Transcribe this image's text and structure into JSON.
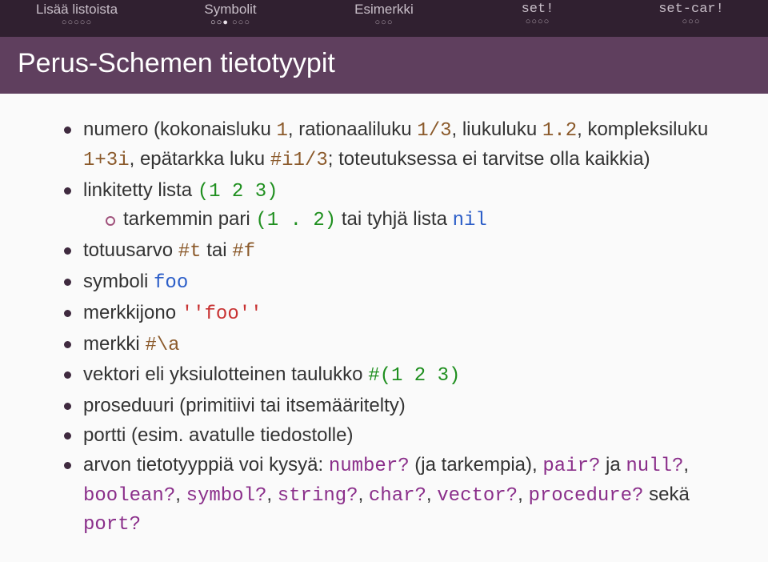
{
  "nav": [
    {
      "label": "Lisää listoista",
      "filled": 0,
      "total": 5,
      "tt": false
    },
    {
      "label": "Symbolit",
      "filled": 3,
      "total": 6,
      "tt": false,
      "split": 3
    },
    {
      "label": "Esimerkki",
      "filled": 0,
      "total": 3,
      "tt": false
    },
    {
      "label": "set!",
      "filled": 0,
      "total": 4,
      "tt": true
    },
    {
      "label": "set-car!",
      "filled": 0,
      "total": 3,
      "tt": true
    }
  ],
  "title": "Perus-Schemen tietotyypit",
  "bullets": {
    "numero": {
      "prefix": "numero (kokonaisluku ",
      "v1": "1",
      "t1": ", rationaaliluku ",
      "v2": "1/3",
      "t2": ", liukuluku ",
      "v3": "1.2",
      "t3": ", kompleksiluku ",
      "v4": "1+3i",
      "t4": ", epätarkka luku ",
      "v5": "#i1/3",
      "t5": "; toteutuksessa ei tarvitse olla kaikkia)"
    },
    "linkitetty": {
      "prefix": "linkitetty lista ",
      "v1": "(1 2 3)"
    },
    "tarkemmin": {
      "prefix": "tarkemmin pari ",
      "v1": "(1 . 2)",
      "mid": " tai tyhjä lista ",
      "v2": "nil"
    },
    "totuus": {
      "prefix": "totuusarvo ",
      "v1": "#t",
      "mid": " tai ",
      "v2": "#f"
    },
    "symboli": {
      "prefix": "symboli ",
      "v1": "foo"
    },
    "merkkijono": {
      "prefix": "merkkijono ",
      "v1": "''foo''"
    },
    "merkki": {
      "prefix": "merkki ",
      "v1": "#\\a"
    },
    "vektori": {
      "prefix": "vektori eli yksiulotteinen taulukko ",
      "v1": "#(1 2 3)"
    },
    "proseduuri": {
      "text": "proseduuri (primitiivi tai itsemääritelty)"
    },
    "portti": {
      "text": "portti (esim. avatulle tiedostolle)"
    },
    "arvon": {
      "prefix": "arvon tietotyyppiä voi kysyä: ",
      "p1": "number?",
      "t1": " (ja tarkempia), ",
      "p2": "pair?",
      "t2": " ja ",
      "p3": "null?",
      "c1": ", ",
      "p4": "boolean?",
      "c2": ", ",
      "p5": "symbol?",
      "c3": ", ",
      "p6": "string?",
      "c4": ", ",
      "p7": "char?",
      "c5": ", ",
      "p8": "vector?",
      "c6": ", ",
      "p9": "procedure?",
      "t3": " sekä ",
      "p10": "port?"
    }
  }
}
